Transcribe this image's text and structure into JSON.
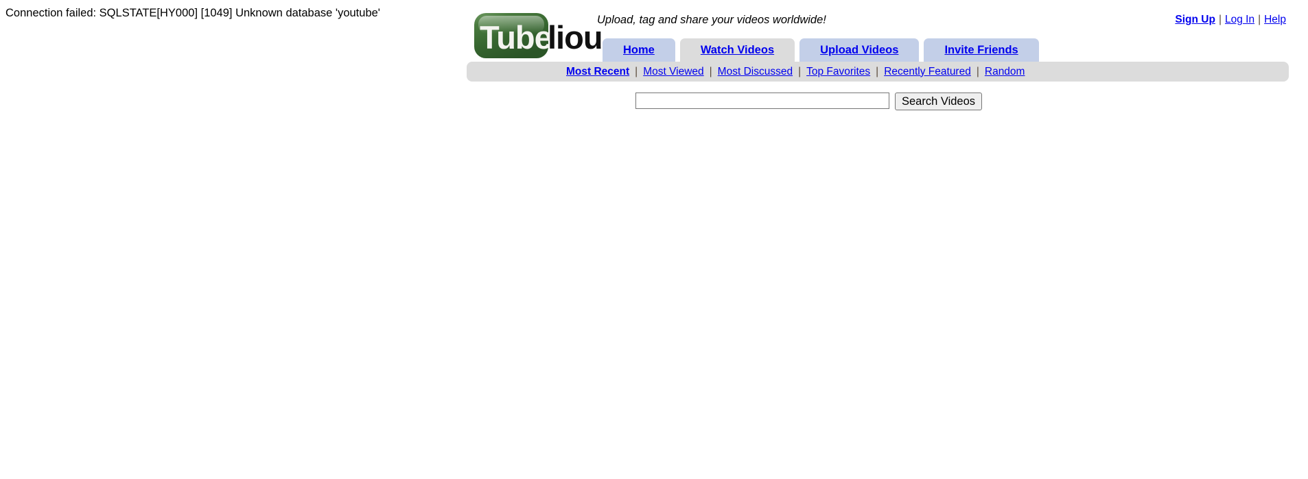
{
  "error": {
    "message": "Connection failed: SQLSTATE[HY000] [1049] Unknown database 'youtube'"
  },
  "header": {
    "logo": {
      "badge_text": "Tube",
      "suffix_text": "lious",
      "badge_color": "#36652f",
      "suffix_color": "#111111",
      "alt": "Tubelious"
    },
    "tagline": "Upload, tag and share your videos worldwide!",
    "account_links": [
      {
        "label": "Sign Up",
        "bold": true
      },
      {
        "label": "Log In",
        "bold": false
      },
      {
        "label": "Help",
        "bold": false
      }
    ],
    "account_separator": "|",
    "tabs": [
      {
        "label": "Home",
        "active": false
      },
      {
        "label": "Watch Videos",
        "active": true
      },
      {
        "label": "Upload Videos",
        "active": false
      },
      {
        "label": "Invite Friends",
        "active": false
      }
    ],
    "subnav": {
      "items": [
        {
          "label": "Most Recent",
          "bold": true
        },
        {
          "label": "Most Viewed",
          "bold": false
        },
        {
          "label": "Most Discussed",
          "bold": false
        },
        {
          "label": "Top Favorites",
          "bold": false
        },
        {
          "label": "Recently Featured",
          "bold": false
        },
        {
          "label": "Random",
          "bold": false
        }
      ],
      "separator": "|"
    },
    "search": {
      "value": "",
      "placeholder": "",
      "button_label": "Search Videos"
    }
  },
  "colors": {
    "tab_inactive": "#c3cfe8",
    "tab_active": "#dcdcdc",
    "subnav_bg": "#dcdcdc",
    "link": "#0000ee",
    "logo_green": "#36652f"
  }
}
